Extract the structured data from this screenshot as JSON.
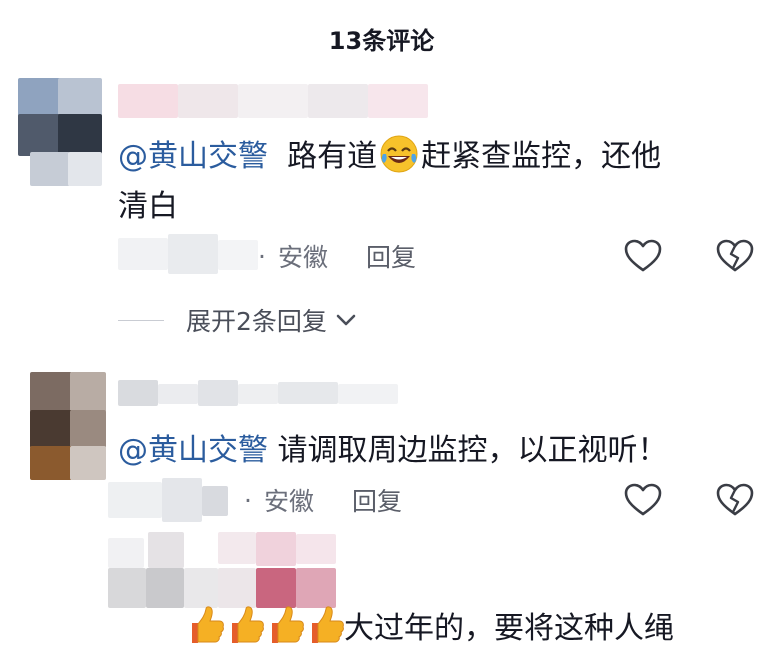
{
  "header": {
    "title": "13条评论"
  },
  "comments": [
    {
      "mention": "@黄山交警",
      "text_before_emoji": "  路有道",
      "emoji": "laughing-crying-emoji",
      "text_after_emoji": "赶紧查监控，还他",
      "text_line2": "清白",
      "meta_dot": "·",
      "location": "安徽",
      "reply_label": "回复",
      "expand_label": "展开2条回复"
    },
    {
      "mention": "@黄山交警",
      "text": " 请调取周边监控，以正视听！",
      "meta_dot": "·",
      "location": "安徽",
      "reply_label": "回复"
    },
    {
      "emoji": "thumbs-up-emoji",
      "emoji_count": 4,
      "text": "大过年的，要将这种人绳"
    }
  ],
  "colors": {
    "mention": "#2b5c9e",
    "meta": "#6b6f7b",
    "text": "#161823"
  }
}
